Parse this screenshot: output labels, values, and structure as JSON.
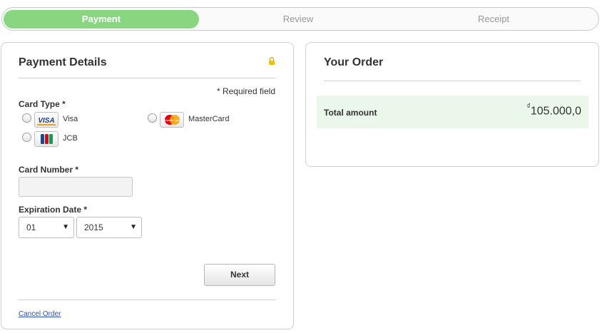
{
  "steps": [
    {
      "label": "Payment",
      "active": true
    },
    {
      "label": "Review",
      "active": false
    },
    {
      "label": "Receipt",
      "active": false
    }
  ],
  "payment_details": {
    "title": "Payment Details",
    "required_note": "* Required field",
    "card_type_label": "Card Type *",
    "cards": [
      {
        "name": "Visa",
        "icon": "visa-card-icon"
      },
      {
        "name": "MasterCard",
        "icon": "mastercard-card-icon"
      },
      {
        "name": "JCB",
        "icon": "jcb-card-icon"
      }
    ],
    "card_number_label": "Card Number *",
    "card_number_value": "",
    "expiration_label": "Expiration Date *",
    "expiration_month": "01",
    "expiration_year": "2015",
    "next_button": "Next",
    "cancel_link": "Cancel Order"
  },
  "order": {
    "title": "Your Order",
    "total_label": "Total amount",
    "currency_symbol": "₫",
    "total_value": "105.000,0"
  },
  "colors": {
    "active_step": "#88d680",
    "total_row_bg": "#ebf7ea",
    "lock_icon": "#f2c200",
    "link": "#2b4fb0"
  }
}
